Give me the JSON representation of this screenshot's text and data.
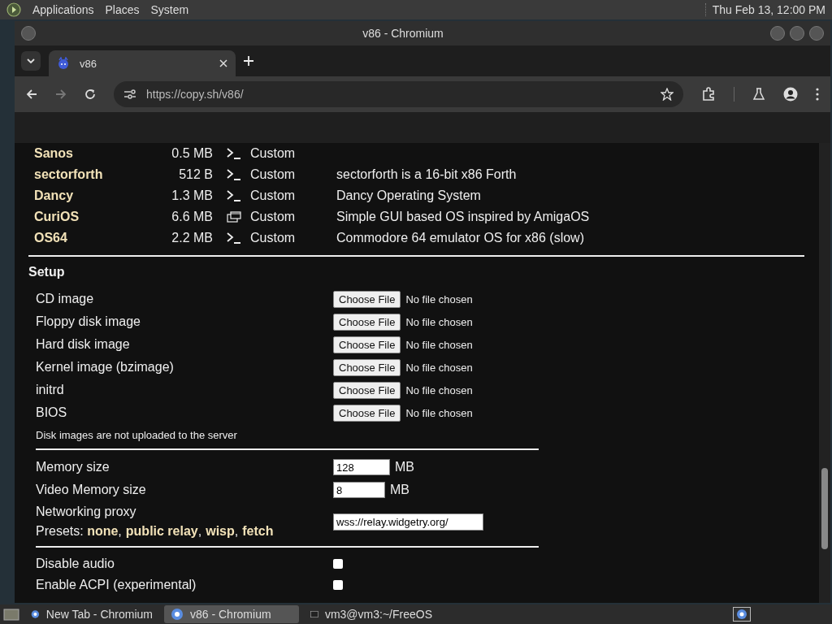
{
  "panel": {
    "menus": [
      "Applications",
      "Places",
      "System"
    ],
    "clock": "Thu Feb 13, 12:00 PM"
  },
  "window": {
    "title": "v86 - Chromium"
  },
  "tabs": [
    {
      "title": "v86",
      "selected": true
    }
  ],
  "address_bar": {
    "url": "https://copy.sh/v86/"
  },
  "os_list": [
    {
      "name": "Sanos",
      "size": "0.5 MB",
      "kind": "terminal",
      "type": "Custom"
    },
    {
      "name": "sectorforth",
      "size": "512 B",
      "kind": "terminal",
      "type": "Custom",
      "description": "sectorforth is a 16-bit x86 Forth"
    },
    {
      "name": "Dancy",
      "size": "1.3 MB",
      "kind": "terminal",
      "type": "Custom",
      "description": "Dancy Operating System"
    },
    {
      "name": "CuriOS",
      "size": "6.6 MB",
      "kind": "gui",
      "type": "Custom",
      "description": "Simple GUI based OS inspired by AmigaOS"
    },
    {
      "name": "OS64",
      "size": "2.2 MB",
      "kind": "terminal",
      "type": "Custom",
      "description": "Commodore 64 emulator OS for x86 (slow)"
    }
  ],
  "setup": {
    "title": "Setup",
    "file_inputs": [
      {
        "label": "CD image",
        "button": "Choose File",
        "status": "No file chosen"
      },
      {
        "label": "Floppy disk image",
        "button": "Choose File",
        "status": "No file chosen"
      },
      {
        "label": "Hard disk image",
        "button": "Choose File",
        "status": "No file chosen"
      },
      {
        "label": "Kernel image (bzimage)",
        "button": "Choose File",
        "status": "No file chosen"
      },
      {
        "label": "initrd",
        "button": "Choose File",
        "status": "No file chosen"
      },
      {
        "label": "BIOS",
        "button": "Choose File",
        "status": "No file chosen"
      }
    ],
    "note": "Disk images are not uploaded to the server",
    "memory": [
      {
        "label": "Memory size",
        "value": "128",
        "unit": "MB"
      },
      {
        "label": "Video Memory size",
        "value": "8",
        "unit": "MB"
      }
    ],
    "proxy": {
      "label": "Networking proxy",
      "presets_label": "Presets:",
      "presets": [
        {
          "label": "none",
          "separator": ","
        },
        {
          "label": "public relay",
          "separator": ","
        },
        {
          "label": "wisp",
          "separator": ","
        },
        {
          "label": "fetch"
        }
      ],
      "value": "wss://relay.widgetry.org/"
    },
    "options": [
      {
        "label": "Disable audio",
        "checked": false
      },
      {
        "label": "Enable ACPI (experimental)",
        "checked": false
      }
    ]
  },
  "taskbar": [
    {
      "title": "New Tab - Chromium",
      "kind": "browser",
      "selected": false
    },
    {
      "title": "v86 - Chromium",
      "kind": "browser",
      "selected": true
    },
    {
      "title": "vm3@vm3:~/FreeOS",
      "kind": "terminal",
      "selected": false
    }
  ]
}
